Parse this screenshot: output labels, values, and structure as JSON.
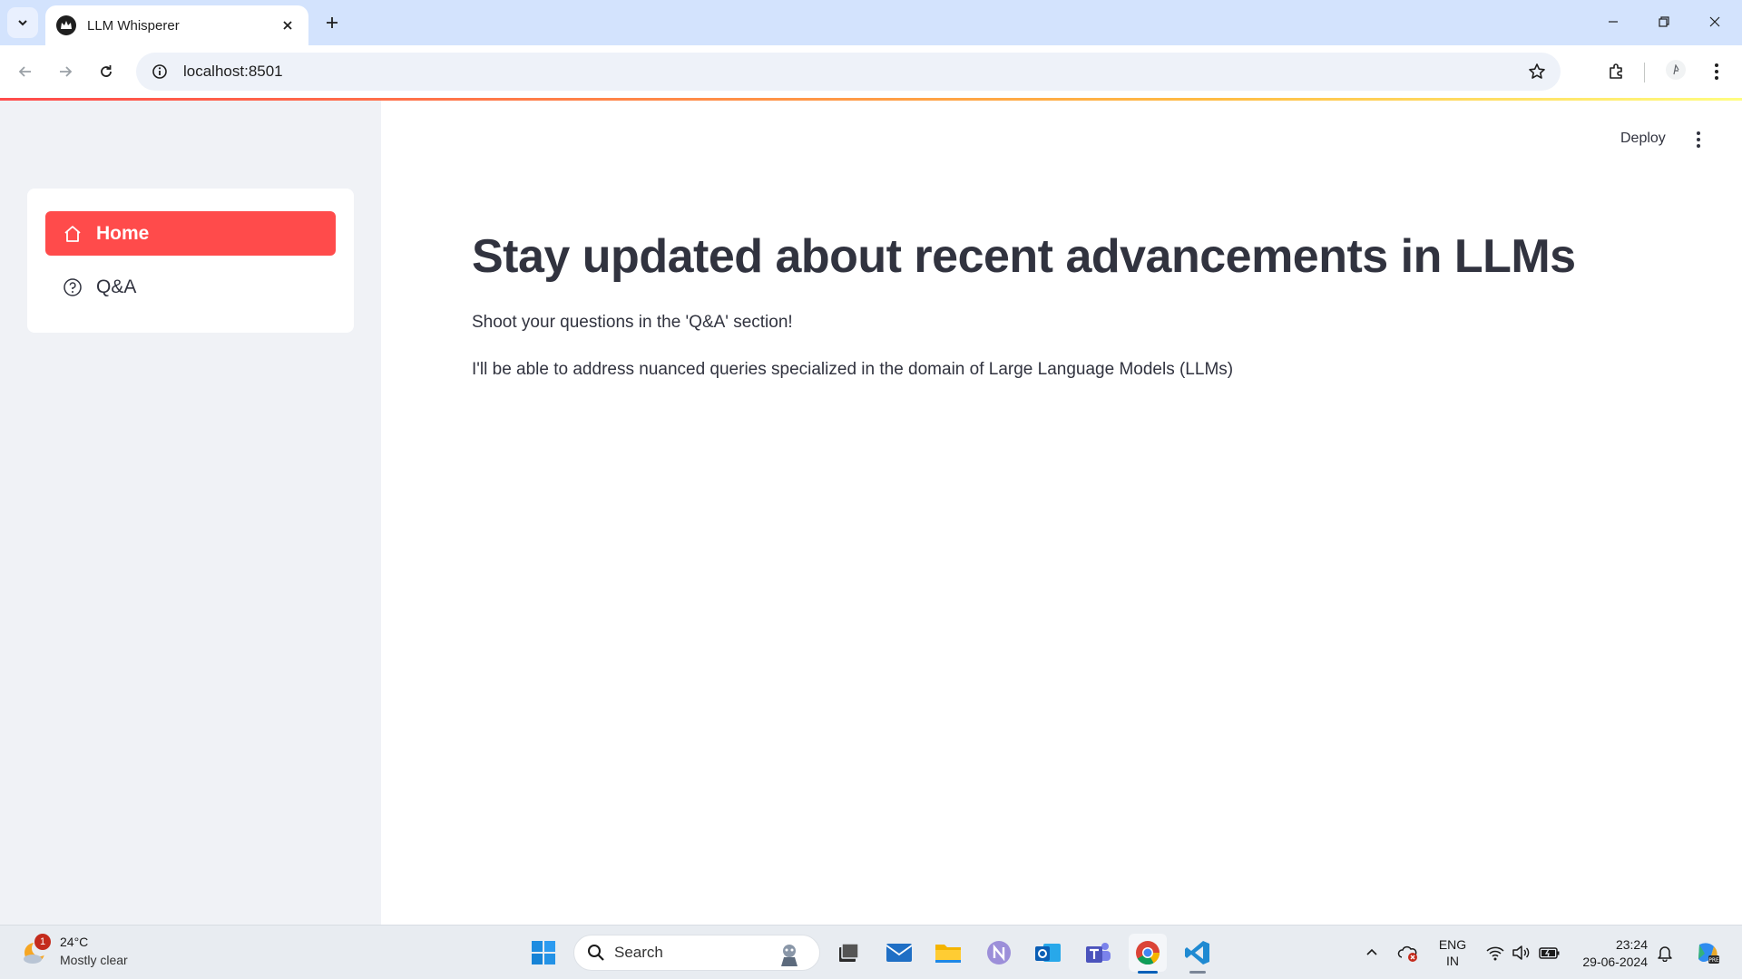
{
  "browser": {
    "tab_title": "LLM Whisperer",
    "url": "localhost:8501"
  },
  "app": {
    "nav": [
      {
        "label": "Home",
        "icon": "home-icon",
        "active": true
      },
      {
        "label": "Q&A",
        "icon": "question-circle-icon",
        "active": false
      }
    ],
    "deploy_label": "Deploy",
    "headline": "Stay updated about recent advancements in LLMs",
    "paragraphs": [
      "Shoot your questions in the 'Q&A' section!",
      "I'll be able to address nuanced queries specialized in the domain of Large Language Models (LLMs)"
    ],
    "colors": {
      "primary": "#ff4b4b",
      "sidebar_bg": "#f0f2f6",
      "text": "#31333f"
    }
  },
  "taskbar": {
    "weather": {
      "temp": "24°C",
      "condition": "Mostly clear",
      "badge": "1"
    },
    "search_placeholder": "Search",
    "apps": [
      "start-icon",
      "search-icon",
      "task-view-icon",
      "mail-icon",
      "file-explorer-icon",
      "onenote-icon",
      "outlook-icon",
      "teams-icon",
      "chrome-icon",
      "vscode-icon"
    ],
    "language": {
      "line1": "ENG",
      "line2": "IN"
    },
    "clock": {
      "time": "23:24",
      "date": "29-06-2024"
    }
  }
}
